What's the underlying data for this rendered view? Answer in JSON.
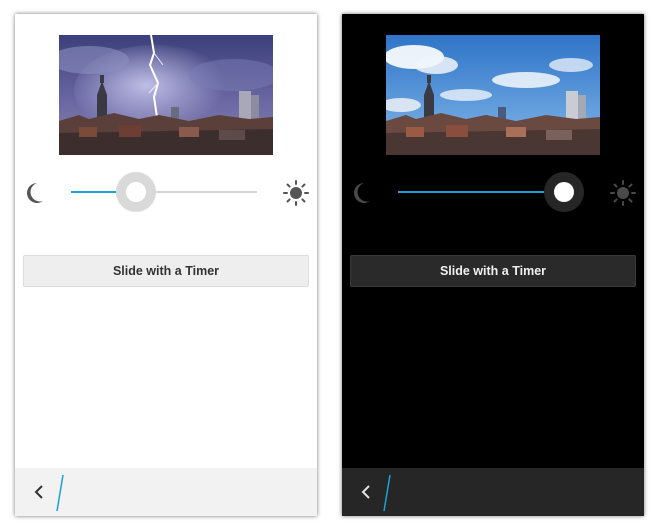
{
  "colors": {
    "accent": "#1aa1d8",
    "light_background": "#ffffff",
    "dark_background": "#000000"
  },
  "screens": [
    {
      "theme": "light",
      "photo": {
        "subject": "city skyline with lightning storm",
        "sky": "dark purple storm"
      },
      "slider": {
        "left_icon": "moon-icon",
        "right_icon": "sun-icon",
        "value_fraction": 0.33
      },
      "timer_button": {
        "label": "Slide with a Timer"
      },
      "action_bar": {
        "back_icon": "back-chevron-icon"
      }
    },
    {
      "theme": "dark",
      "photo": {
        "subject": "city skyline under blue sky",
        "sky": "clear blue with clouds"
      },
      "slider": {
        "left_icon": "moon-icon",
        "right_icon": "sun-icon",
        "value_fraction": 0.89
      },
      "timer_button": {
        "label": "Slide with a Timer"
      },
      "action_bar": {
        "back_icon": "back-chevron-icon"
      }
    }
  ]
}
